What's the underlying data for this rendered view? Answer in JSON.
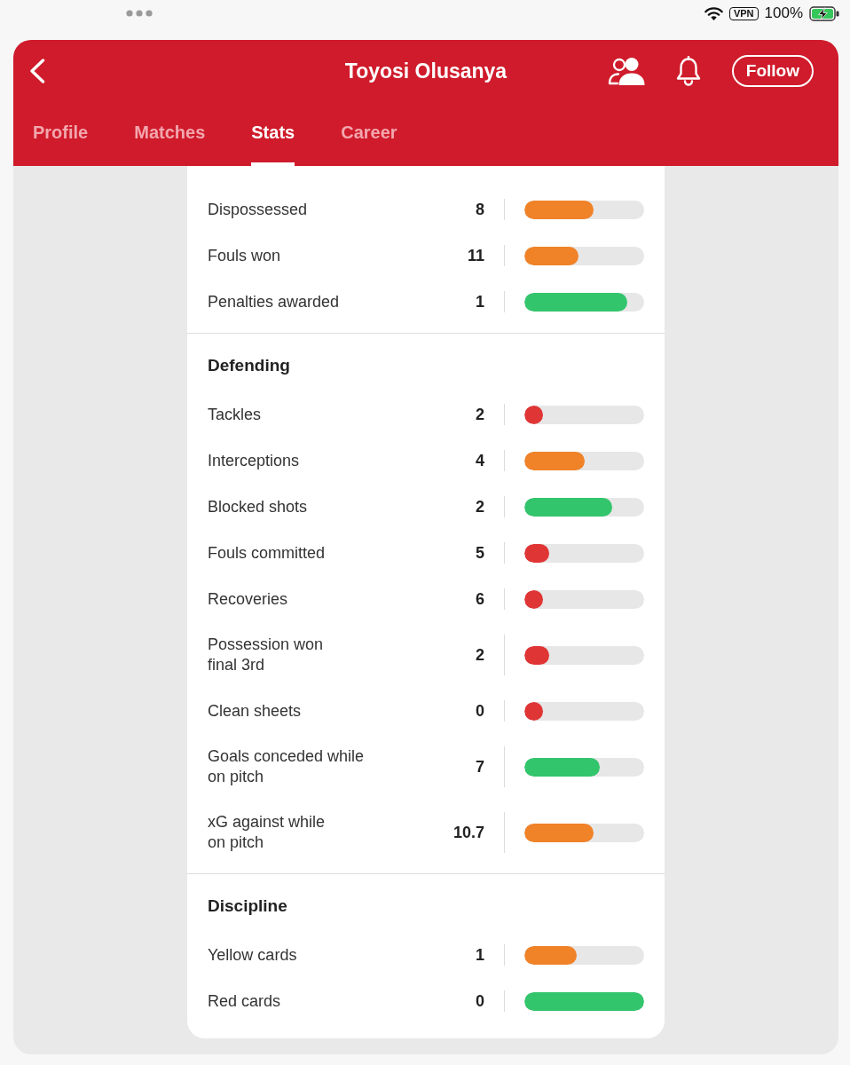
{
  "status_bar": {
    "vpn": "VPN",
    "battery": "100%"
  },
  "header": {
    "title": "Toyosi Olusanya",
    "follow_button": "Follow"
  },
  "tabs": [
    {
      "label": "Profile",
      "selected": false
    },
    {
      "label": "Matches",
      "selected": false
    },
    {
      "label": "Stats",
      "selected": true
    },
    {
      "label": "Career",
      "selected": false
    }
  ],
  "stats": {
    "sections": [
      {
        "rows": [
          {
            "label": "Dispossessed",
            "value": "8",
            "level": 0.58,
            "color": "#f08228"
          },
          {
            "label": "Fouls won",
            "value": "11",
            "level": 0.45,
            "color": "#f08228"
          },
          {
            "label": "Penalties awarded",
            "value": "1",
            "level": 0.86,
            "color": "#33c56c"
          }
        ]
      },
      {
        "title": "Defending",
        "rows": [
          {
            "label": "Tackles",
            "value": "2",
            "level": 0.15,
            "color": "#e03535"
          },
          {
            "label": "Interceptions",
            "value": "4",
            "level": 0.5,
            "color": "#f08228"
          },
          {
            "label": "Blocked shots",
            "value": "2",
            "level": 0.73,
            "color": "#33c56c"
          },
          {
            "label": "Fouls committed",
            "value": "5",
            "level": 0.21,
            "color": "#e03535"
          },
          {
            "label": "Recoveries",
            "value": "6",
            "level": 0.15,
            "color": "#e03535"
          },
          {
            "label": "Possession won\nfinal 3rd",
            "value": "2",
            "level": 0.21,
            "color": "#e03535"
          },
          {
            "label": "Clean sheets",
            "value": "0",
            "level": 0.15,
            "color": "#e03535"
          },
          {
            "label": "Goals conceded while\non pitch",
            "value": "7",
            "level": 0.63,
            "color": "#33c56c"
          },
          {
            "label": "xG against while\non pitch",
            "value": "10.7",
            "level": 0.58,
            "color": "#f08228"
          }
        ]
      },
      {
        "title": "Discipline",
        "rows": [
          {
            "label": "Yellow cards",
            "value": "1",
            "level": 0.44,
            "color": "#f08228"
          },
          {
            "label": "Red cards",
            "value": "0",
            "level": 1.0,
            "color": "#33c56c"
          }
        ]
      }
    ]
  }
}
